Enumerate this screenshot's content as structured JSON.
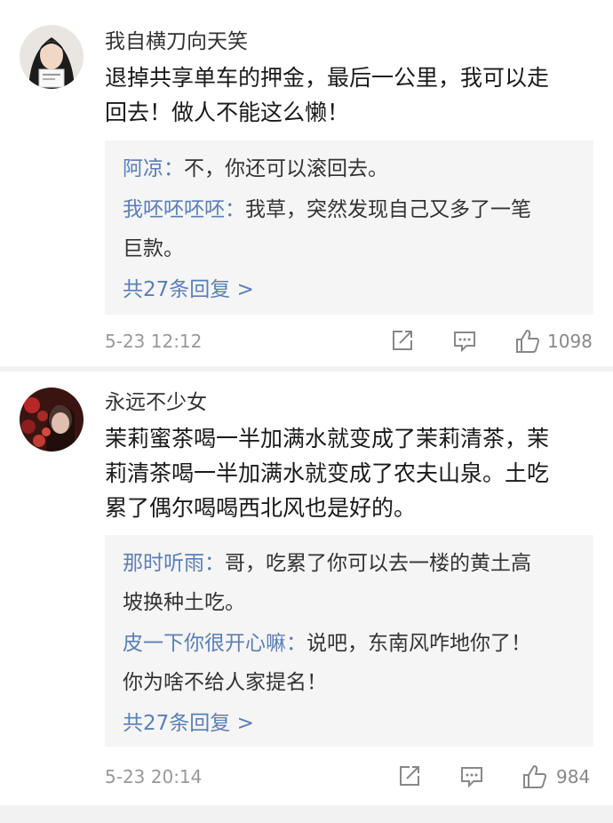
{
  "comments": [
    {
      "username": "我自横刀向天笑",
      "text_lines": [
        "退掉共享单车的押金，最后一公里，我可以走",
        "回去！做人不能这么懒！"
      ],
      "replies": [
        {
          "author": "阿凉",
          "sep": "：",
          "lines": [
            "不，你还可以滚回去。"
          ]
        },
        {
          "author": "我呸呸呸呸",
          "sep": "：",
          "lines": [
            "我草，突然发现自己又多了一笔",
            "巨款。"
          ]
        }
      ],
      "more_replies": "共27条回复 >",
      "timestamp": "5-23  12:12",
      "likes": "1098",
      "share_icon": "share-icon",
      "comment_icon": "comment-icon",
      "like_icon": "thumbs-up-icon"
    },
    {
      "username": "永远不少女",
      "text_lines": [
        "茉莉蜜茶喝一半加满水就变成了茉莉清茶，茉",
        "莉清茶喝一半加满水就变成了农夫山泉。土吃",
        "累了偶尔喝喝西北风也是好的。"
      ],
      "replies": [
        {
          "author": "那时听雨",
          "sep": "：",
          "lines": [
            "哥，吃累了你可以去一楼的黄土高",
            "坡换种土吃。"
          ]
        },
        {
          "author": "皮一下你很开心嘛",
          "sep": "：",
          "lines": [
            "说吧，东南风咋地你了！",
            "你为啥不给人家提名！"
          ]
        }
      ],
      "more_replies": "共27条回复 >",
      "timestamp": "5-23  20:14",
      "likes": "984",
      "share_icon": "share-icon",
      "comment_icon": "comment-icon",
      "like_icon": "thumbs-up-icon"
    }
  ],
  "colors": {
    "author_link": "#5b7fb5",
    "reply_bg": "#f5f5f5",
    "meta_gray": "#999999"
  }
}
